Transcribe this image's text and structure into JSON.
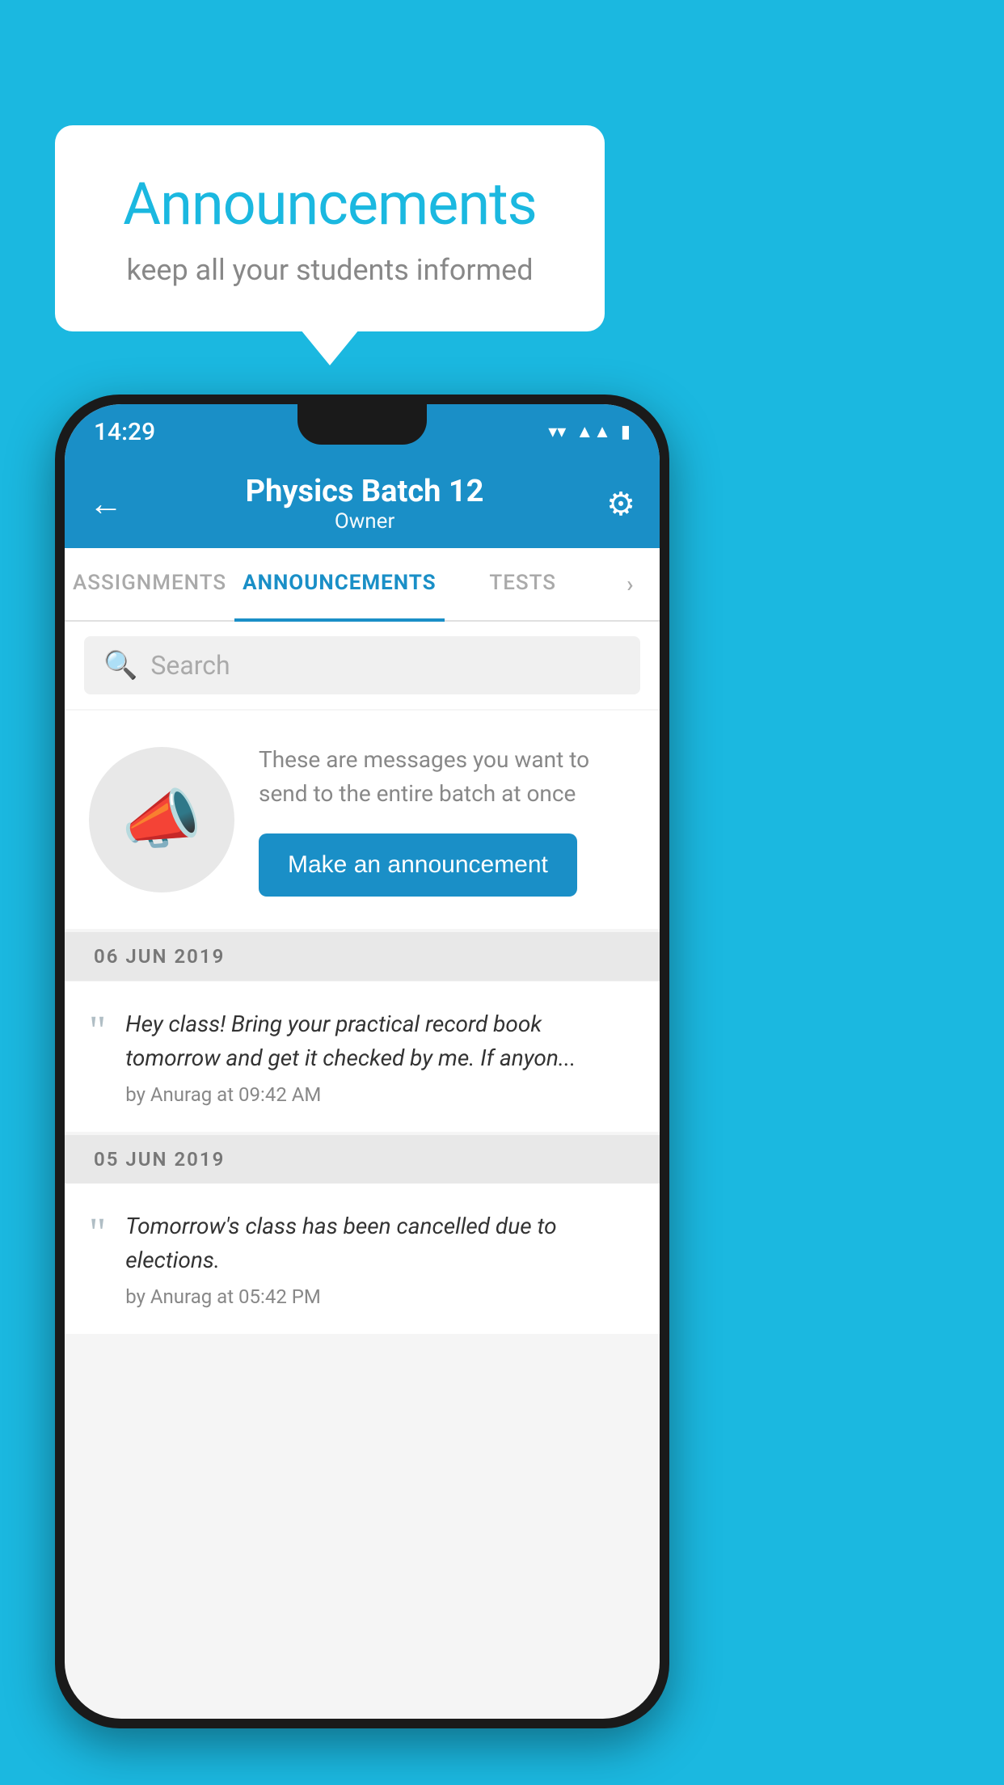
{
  "background_color": "#1bb8e0",
  "speech_bubble": {
    "title": "Announcements",
    "subtitle": "keep all your students informed"
  },
  "status_bar": {
    "time": "14:29",
    "icons": [
      "wifi",
      "signal",
      "battery"
    ]
  },
  "app_header": {
    "title": "Physics Batch 12",
    "subtitle": "Owner",
    "back_label": "←",
    "gear_label": "⚙"
  },
  "tabs": [
    {
      "label": "ASSIGNMENTS",
      "active": false
    },
    {
      "label": "ANNOUNCEMENTS",
      "active": true
    },
    {
      "label": "TESTS",
      "active": false
    },
    {
      "label": "...",
      "active": false
    }
  ],
  "search": {
    "placeholder": "Search"
  },
  "promo": {
    "description": "These are messages you want to send to the entire batch at once",
    "button_label": "Make an announcement"
  },
  "announcements": [
    {
      "date": "06  JUN  2019",
      "text": "Hey class! Bring your practical record book tomorrow and get it checked by me. If anyon...",
      "meta": "by Anurag at 09:42 AM"
    },
    {
      "date": "05  JUN  2019",
      "text": "Tomorrow's class has been cancelled due to elections.",
      "meta": "by Anurag at 05:42 PM"
    }
  ]
}
